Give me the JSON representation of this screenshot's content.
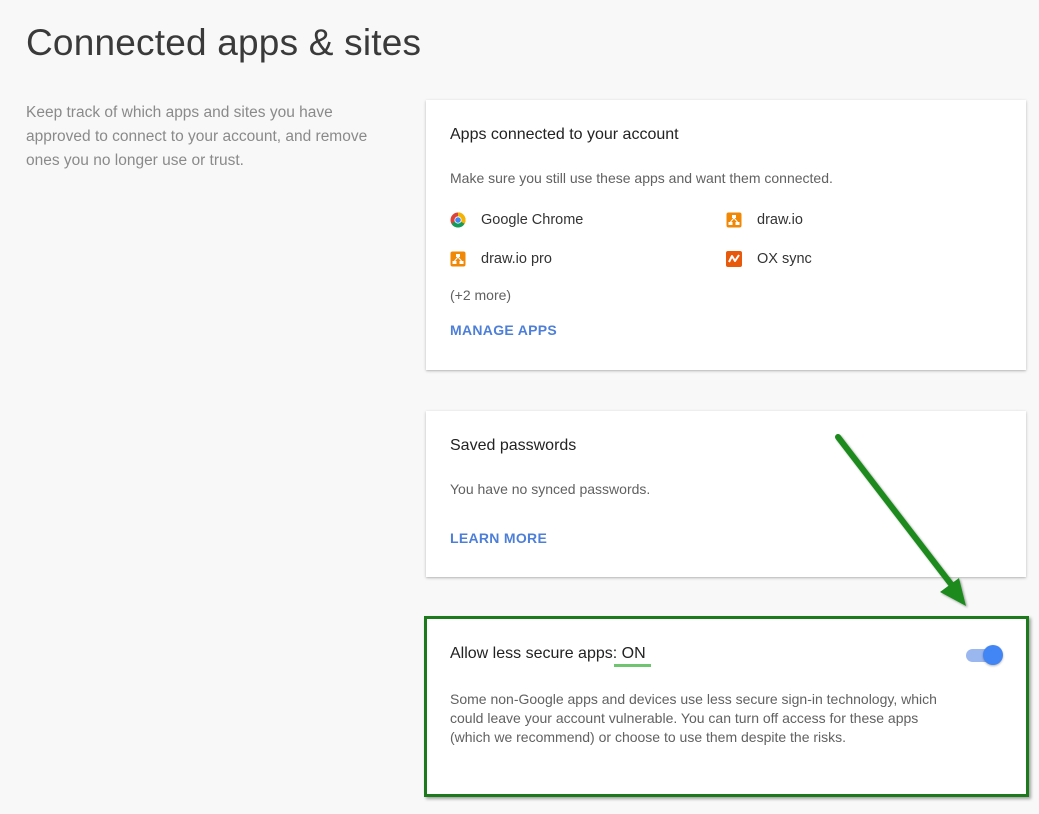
{
  "page": {
    "title": "Connected apps & sites",
    "intro": "Keep track of which apps and sites you have approved to connect to your account, and remove ones you no longer use or trust."
  },
  "apps_card": {
    "title": "Apps connected to your account",
    "description": "Make sure you still use these apps and want them connected.",
    "apps": [
      {
        "label": "Google Chrome",
        "icon": "chrome-icon"
      },
      {
        "label": "draw.io",
        "icon": "drawio-icon"
      },
      {
        "label": "draw.io pro",
        "icon": "drawio-icon"
      },
      {
        "label": "OX sync",
        "icon": "ox-sync-icon"
      }
    ],
    "more": "(+2 more)",
    "manage_label": "MANAGE APPS"
  },
  "passwords_card": {
    "title": "Saved passwords",
    "description": "You have no synced passwords.",
    "learn_more_label": "LEARN MORE"
  },
  "less_secure_card": {
    "title": "Allow less secure apps: ON",
    "toggle_state": "on",
    "description": "Some non-Google apps and devices use less secure sign-in technology, which could leave your account vulnerable. You can turn off access for these apps (which we recommend) or choose to use them despite the risks."
  },
  "colors": {
    "link": "#4d7fd9",
    "toggle_on": "#4285f4",
    "annotation": "#1c7a1c"
  }
}
